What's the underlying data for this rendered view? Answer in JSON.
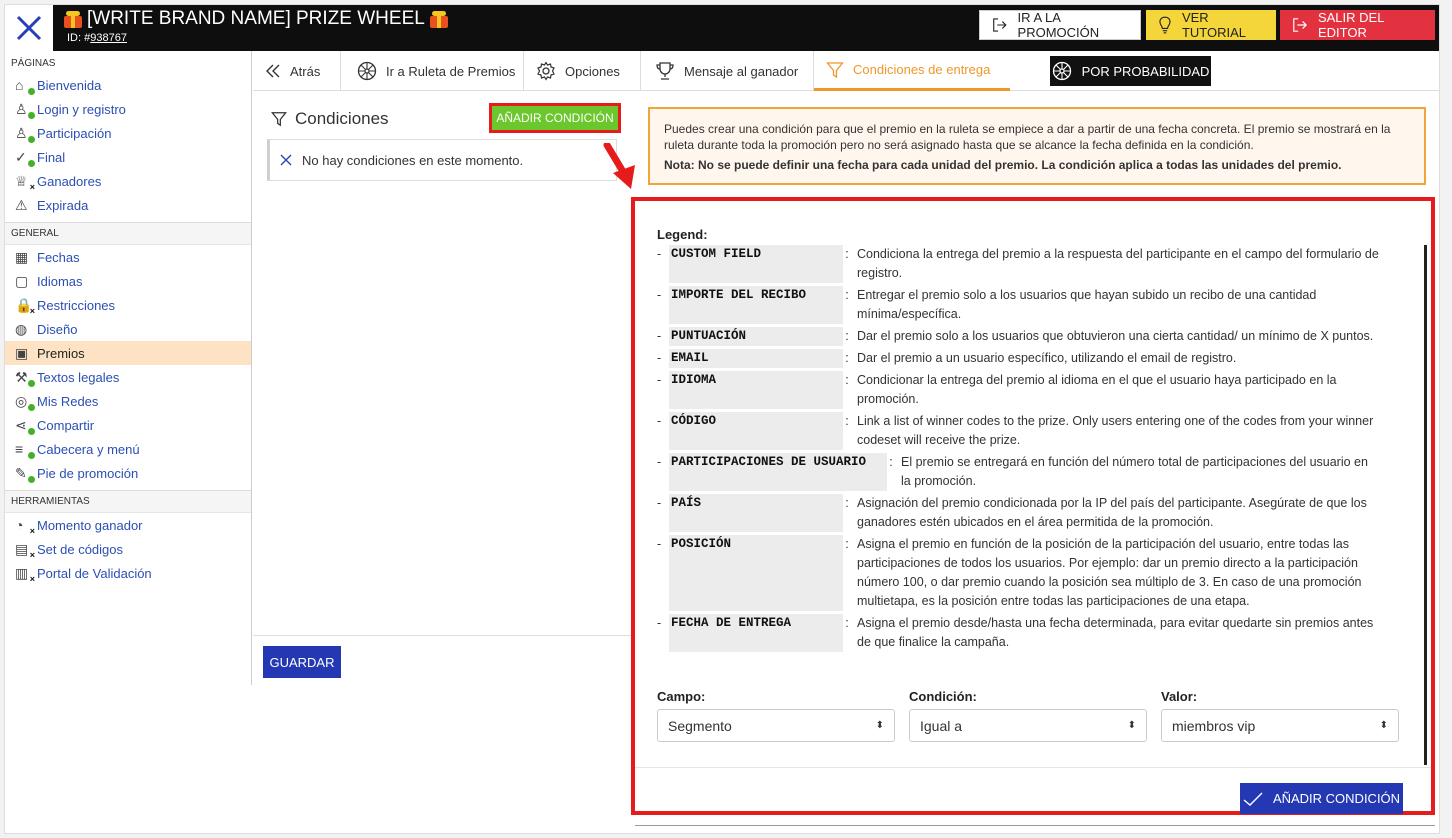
{
  "header": {
    "title": "[WRITE BRAND NAME] PRIZE WHEEL",
    "id_label": "ID: #",
    "id_value": "938767",
    "btn_promo": "IR A LA PROMOCIÓN",
    "btn_tutorial": "VER TUTORIAL",
    "btn_salir": "SALIR DEL EDITOR"
  },
  "sidebar": {
    "paginas_label": "PÁGINAS",
    "paginas": [
      {
        "label": "Bienvenida",
        "icon": "home-icon",
        "badge": "dot"
      },
      {
        "label": "Login y registro",
        "icon": "user-icon",
        "badge": "dot"
      },
      {
        "label": "Participación",
        "icon": "user-icon",
        "badge": "dot"
      },
      {
        "label": "Final",
        "icon": "check-icon",
        "badge": "dot"
      },
      {
        "label": "Ganadores",
        "icon": "trophy-icon",
        "badge": "x"
      },
      {
        "label": "Expirada",
        "icon": "warning-icon",
        "badge": ""
      }
    ],
    "general_label": "GENERAL",
    "general": [
      {
        "label": "Fechas",
        "icon": "calendar-icon",
        "badge": ""
      },
      {
        "label": "Idiomas",
        "icon": "chat-icon",
        "badge": ""
      },
      {
        "label": "Restricciones",
        "icon": "lock-icon",
        "badge": "x"
      },
      {
        "label": "Diseño",
        "icon": "palette-icon",
        "badge": ""
      },
      {
        "label": "Premios",
        "icon": "gift-icon",
        "badge": ""
      },
      {
        "label": "Textos legales",
        "icon": "gavel-icon",
        "badge": "dot"
      },
      {
        "label": "Mis Redes",
        "icon": "globe-icon",
        "badge": "dot"
      },
      {
        "label": "Compartir",
        "icon": "share-icon",
        "badge": "dot"
      },
      {
        "label": "Cabecera y menú",
        "icon": "menu-icon",
        "badge": "dot"
      },
      {
        "label": "Pie de promoción",
        "icon": "footer-icon",
        "badge": "dot"
      }
    ],
    "herramientas_label": "HERRAMIENTAS",
    "herramientas": [
      {
        "label": "Momento ganador",
        "icon": "timer-icon",
        "badge": "x"
      },
      {
        "label": "Set de códigos",
        "icon": "codes-icon",
        "badge": "x"
      },
      {
        "label": "Portal de Validación",
        "icon": "ticket-icon",
        "badge": "x"
      }
    ]
  },
  "tabs": {
    "back": "Atrás",
    "wheel": "Ir a Ruleta de Premios",
    "options": "Opciones",
    "winner_msg": "Mensaje al ganador",
    "delivery": "Condiciones de entrega",
    "probability": "POR PROBABILIDAD"
  },
  "conditions": {
    "title": "Condiciones",
    "add_button": "AÑADIR CONDICIÓN",
    "empty": "No hay condiciones en este momento.",
    "save": "GUARDAR"
  },
  "info": {
    "text": "Puedes crear una condición para que el premio en la ruleta se empiece a dar a partir de una fecha concreta. El premio se mostrará en la ruleta durante toda la promoción pero no será asignado hasta que se alcance la fecha definida en la condición.",
    "note": "Nota: No se puede definir una fecha para cada unidad del premio. La condición aplica a todas las unidades del premio."
  },
  "modal": {
    "legend_title": "Legend:",
    "legend": [
      {
        "key": "CUSTOM FIELD",
        "desc": "Condiciona la entrega del premio a la respuesta del participante en el campo del formulario de registro."
      },
      {
        "key": "IMPORTE DEL RECIBO",
        "desc": "Entregar el premio solo a los usuarios que hayan subido un recibo de una cantidad mínima/específica."
      },
      {
        "key": "PUNTUACIÓN",
        "desc": "Dar el premio solo a los usuarios que obtuvieron una cierta cantidad/ un mínimo de X puntos."
      },
      {
        "key": "EMAIL",
        "desc": "Dar el premio a un usuario específico, utilizando el email de registro."
      },
      {
        "key": "IDIOMA",
        "desc": "Condicionar la entrega del premio al idioma en el que el usuario haya participado en la promoción."
      },
      {
        "key": "CÓDIGO",
        "desc": "Link a list of winner codes to the prize. Only users entering one of the codes from your winner codeset will receive the prize."
      },
      {
        "key": "PARTICIPACIONES DE USUARIO",
        "desc": "El premio se entregará en función del número total de participaciones del usuario en la promoción."
      },
      {
        "key": "PAÍS",
        "desc": "Asignación del premio condicionada por la IP del país del participante. Asegúrate de que los ganadores estén ubicados en el área permitida de la promoción."
      },
      {
        "key": "POSICIÓN",
        "desc": "Asigna el premio en función de la posición de la participación del usuario, entre todas las participaciones de todos los usuarios. Por ejemplo: dar un premio directo a la participación número 100, o dar premio cuando la posición sea múltiplo de 3. En caso de una promoción multietapa, es la posición entre todas las participaciones de una etapa."
      },
      {
        "key": "FECHA DE ENTREGA",
        "desc": "Asigna el premio desde/hasta una fecha determinada, para evitar quedarte sin premios antes de que finalice la campaña."
      }
    ],
    "campo_label": "Campo:",
    "campo_value": "Segmento",
    "condicion_label": "Condición:",
    "condicion_value": "Igual a",
    "valor_label": "Valor:",
    "valor_value": "miembros vip",
    "add_button": "AÑADIR CONDICIÓN"
  }
}
